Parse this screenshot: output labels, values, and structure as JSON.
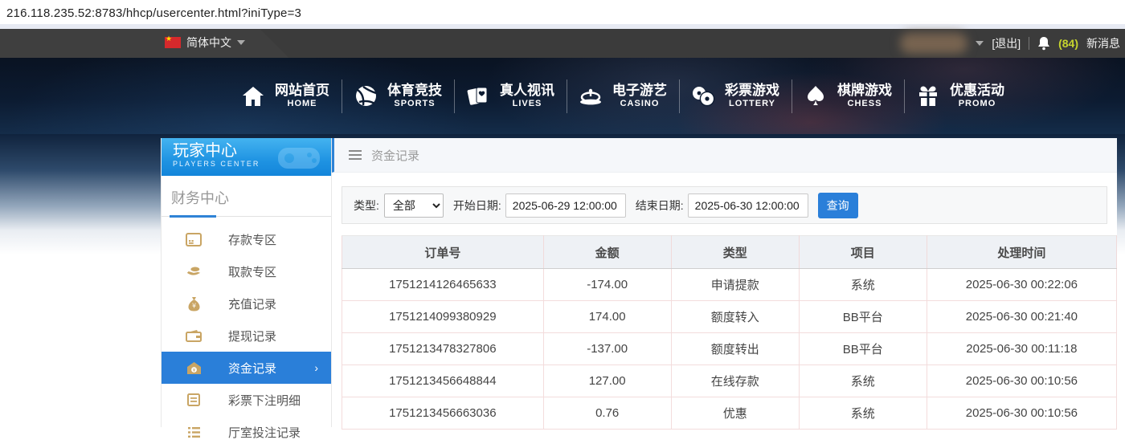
{
  "url_bar": {
    "url": "216.118.235.52:8783/hhcp/usercenter.html?iniType=3"
  },
  "top_bar": {
    "language": "简体中文",
    "logout": "[退出]",
    "message_count": "(84)",
    "new_message_label": "新消息"
  },
  "nav": {
    "items": [
      {
        "zh": "网站首页",
        "en": "HOME",
        "icon": "home-icon"
      },
      {
        "zh": "体育竞技",
        "en": "SPORTS",
        "icon": "sports-ball-icon"
      },
      {
        "zh": "真人视讯",
        "en": "LIVES",
        "icon": "cards-icon"
      },
      {
        "zh": "电子游艺",
        "en": "CASINO",
        "icon": "roulette-icon"
      },
      {
        "zh": "彩票游戏",
        "en": "LOTTERY",
        "icon": "lottery-balls-icon"
      },
      {
        "zh": "棋牌游戏",
        "en": "CHESS",
        "icon": "spade-icon"
      },
      {
        "zh": "优惠活动",
        "en": "PROMO",
        "icon": "gift-icon"
      }
    ]
  },
  "sidebar": {
    "title_zh": "玩家中心",
    "title_en": "PLAYERS CENTER",
    "section": "财务中心",
    "items": [
      {
        "label": "存款专区",
        "icon": "deposit-card-icon",
        "active": false
      },
      {
        "label": "取款专区",
        "icon": "withdraw-hand-icon",
        "active": false
      },
      {
        "label": "充值记录",
        "icon": "money-bag-icon",
        "active": false
      },
      {
        "label": "提现记录",
        "icon": "wallet-icon",
        "active": false
      },
      {
        "label": "资金记录",
        "icon": "coin-purse-icon",
        "active": true
      },
      {
        "label": "彩票下注明细",
        "icon": "document-icon",
        "active": false
      },
      {
        "label": "厅室投注记录",
        "icon": "list-icon",
        "active": false
      }
    ]
  },
  "breadcrumb": {
    "title": "资金记录"
  },
  "filter": {
    "type_label": "类型:",
    "type_value": "全部",
    "start_label": "开始日期:",
    "start_value": "2025-06-29 12:00:00",
    "end_label": "结束日期:",
    "end_value": "2025-06-30 12:00:00",
    "search_button": "查询"
  },
  "table": {
    "headers": [
      "订单号",
      "金额",
      "类型",
      "项目",
      "处理时间"
    ],
    "rows": [
      [
        "1751214126465633",
        "-174.00",
        "申请提款",
        "系统",
        "2025-06-30 00:22:06"
      ],
      [
        "1751214099380929",
        "174.00",
        "额度转入",
        "BB平台",
        "2025-06-30 00:21:40"
      ],
      [
        "1751213478327806",
        "-137.00",
        "额度转出",
        "BB平台",
        "2025-06-30 00:11:18"
      ],
      [
        "1751213456648844",
        "127.00",
        "在线存款",
        "系统",
        "2025-06-30 00:10:56"
      ],
      [
        "1751213456663036",
        "0.76",
        "优惠",
        "系统",
        "2025-06-30 00:10:56"
      ]
    ]
  },
  "colors": {
    "accent_blue": "#2a7fd9",
    "sidebar_header_blue": "#1f93e2",
    "gold_icon": "#c9a564",
    "topbar_gray": "#3b3b3b",
    "badge_green": "#c6d42e",
    "table_border_pink": "#f0dada"
  }
}
